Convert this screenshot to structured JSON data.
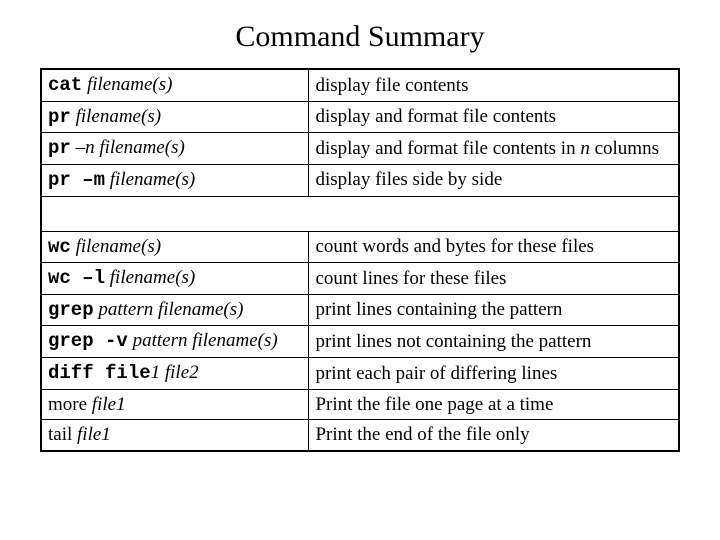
{
  "title": "Command Summary",
  "rows": [
    {
      "cmd_html": "<span class='mono'>cat</span> <span class='ital'>filename(s)</span>",
      "desc_html": "display file contents"
    },
    {
      "cmd_html": "<span class='mono'>pr</span> <span class='ital'>filename(s)</span>",
      "desc_html": "display and format file contents"
    },
    {
      "cmd_html": "<span class='mono'>pr</span> <span class='ital'>–n  filename(s)</span>",
      "desc_html": "display and format file contents in <span class='ital'>n</span> columns"
    },
    {
      "cmd_html": "<span class='mono'>pr –m</span> <span class='ital'>filename(s)</span>",
      "desc_html": "display files side by side"
    },
    {
      "spacer": true
    },
    {
      "cmd_html": "<span class='mono'>wc</span> <span class='ital'>filename(s)</span>",
      "desc_html": "count words and bytes for these files"
    },
    {
      "cmd_html": "<span class='mono'>wc –l</span> <span class='ital'>filename(s)</span>",
      "desc_html": "count lines for these files"
    },
    {
      "cmd_html": "<span class='mono'>grep</span> <span class='ital'>pattern  filename(s)</span>",
      "desc_html": "print lines containing the pattern"
    },
    {
      "cmd_html": "<span class='mono'>grep -v</span> <span class='ital'>pattern  filename(s)</span>",
      "desc_html": "print lines not containing the pattern"
    },
    {
      "cmd_html": "<span class='mono'>diff file</span><span class='plain ital'>1</span> <span class='ital'>file</span><span class='plain ital'>2</span>",
      "desc_html": "print each pair of differing lines"
    },
    {
      "cmd_html": "<span class='plain'>more </span><span class='ital'>file1</span>",
      "desc_html": "Print the file one page at a time"
    },
    {
      "cmd_html": "<span class='plain'>tail </span> <span class='ital'>file1</span>",
      "desc_html": "Print the end of the file only"
    }
  ]
}
